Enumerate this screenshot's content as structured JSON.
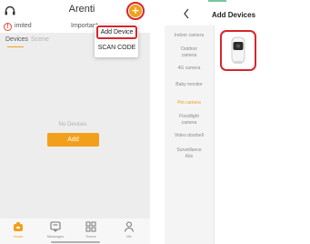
{
  "left_screen": {
    "app_title": "Arenti",
    "status": {
      "text": "imited",
      "important": "Important"
    },
    "tabs": [
      "Devices",
      "Scene"
    ],
    "dropdown": {
      "add_device": "Add Device",
      "scan_code": "SCAN CODE"
    },
    "empty_text": "No Devices",
    "add_button": "Add",
    "nav": [
      "Home",
      "Messages",
      "Scene",
      "Me"
    ],
    "accent_color": "#f2a01c",
    "highlight_color": "#d7262b"
  },
  "right_screen": {
    "back_label": "<",
    "title": "Add Devices",
    "categories": [
      "Indoor camera",
      "Outdoor camera",
      "4G camera",
      "Baby monitor",
      "Pet camera",
      "Floodlight camera",
      "Video doorbell",
      "Surveillance Kits"
    ],
    "active_category": "Pet camera",
    "product_icon": "pet-camera-device-icon"
  }
}
